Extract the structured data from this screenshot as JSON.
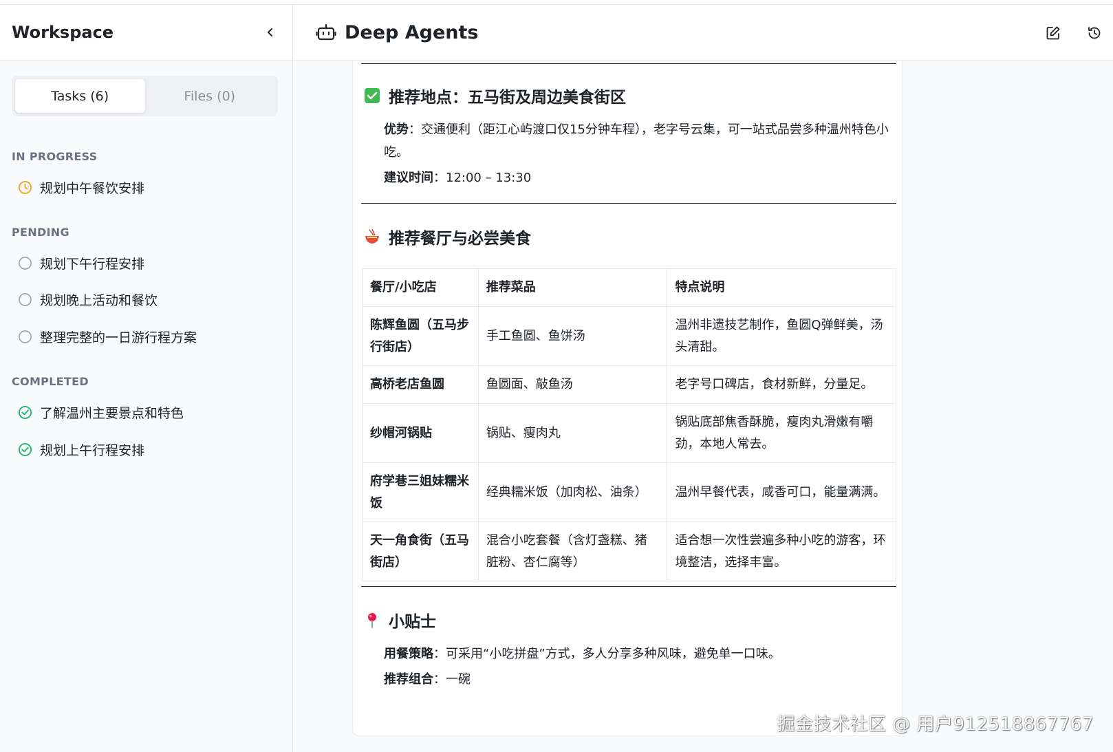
{
  "sidebar": {
    "title": "Workspace",
    "tabs": [
      {
        "label": "Tasks (6)",
        "active": true
      },
      {
        "label": "Files (0)",
        "active": false
      }
    ],
    "sections": {
      "in_progress": {
        "label": "IN PROGRESS",
        "items": [
          "规划中午餐饮安排"
        ]
      },
      "pending": {
        "label": "PENDING",
        "items": [
          "规划下午行程安排",
          "规划晚上活动和餐饮",
          "整理完整的一日游行程方案"
        ]
      },
      "completed": {
        "label": "COMPLETED",
        "items": [
          "了解温州主要景点和特色",
          "规划上午行程安排"
        ]
      }
    }
  },
  "header": {
    "title": "Deep Agents",
    "icons": [
      "bot-icon",
      "edit-icon",
      "history-icon"
    ]
  },
  "content": {
    "location": {
      "title": "推荐地点：五马街及周边美食街区",
      "advantage_label": "优势",
      "advantage_text": "：交通便利（距江心屿渡口仅15分钟车程），老字号云集，可一站式品尝多种温州特色小吃。",
      "time_label": "建议时间",
      "time_text": "：12:00 – 13:30"
    },
    "restaurants": {
      "title": "推荐餐厅与必尝美食",
      "headers": [
        "餐厅/小吃店",
        "推荐菜品",
        "特点说明"
      ],
      "rows": [
        [
          "陈辉鱼圆（五马步行街店）",
          "手工鱼圆、鱼饼汤",
          "温州非遗技艺制作，鱼圆Q弹鲜美，汤头清甜。"
        ],
        [
          "高桥老店鱼圆",
          "鱼圆面、敲鱼汤",
          "老字号口碑店，食材新鲜，分量足。"
        ],
        [
          "纱帽河锅贴",
          "锅贴、瘦肉丸",
          "锅贴底部焦香酥脆，瘦肉丸滑嫩有嚼劲，本地人常去。"
        ],
        [
          "府学巷三姐妹糯米饭",
          "经典糯米饭（加肉松、油条）",
          "温州早餐代表，咸香可口，能量满满。"
        ],
        [
          "天一角食街（五马街店）",
          "混合小吃套餐（含灯盏糕、猪脏粉、杏仁腐等）",
          "适合想一次性尝遍多种小吃的游客，环境整洁，选择丰富。"
        ]
      ]
    },
    "tips": {
      "title": "小贴士",
      "strategy_label": "用餐策略",
      "strategy_text": "：可采用“小吃拼盘”方式，多人分享多种风味，避免单一口味。",
      "combo_label": "推荐组合",
      "combo_text": "：一碗"
    }
  },
  "watermark": "掘金技术社区 @ 用户912518867767",
  "colors": {
    "accent_in_progress": "#f5a524",
    "accent_completed": "#22b573",
    "pending_ring": "#9aa0a8",
    "checkbox_green": "#3fb950"
  }
}
